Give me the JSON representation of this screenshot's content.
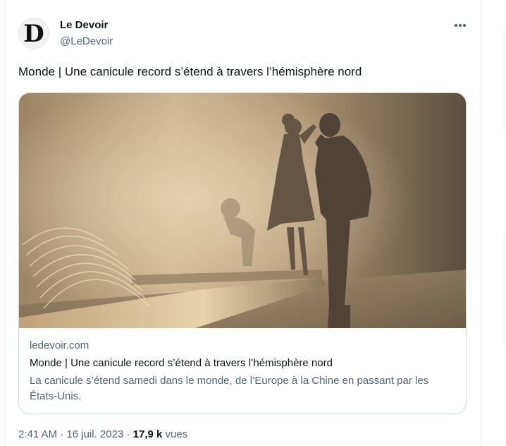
{
  "tweet": {
    "author": {
      "display_name": "Le Devoir",
      "handle": "@LeDevoir",
      "avatar_letter": "D"
    },
    "more_icon": "more-horizontal-icon",
    "text": "Monde | Une canicule record s’étend à travers l’hémisphère nord",
    "card": {
      "domain": "ledevoir.com",
      "title": "Monde | Une canicule record s’étend à travers l’hémisphère nord",
      "description": "La canicule s’étend samedi dans le monde, de l’Europe à la Chine en passant par les États-Unis."
    },
    "meta": {
      "time": "2:41 AM",
      "separator": "·",
      "date": "16 juil. 2023",
      "views_count": "17,9 k",
      "views_label": "vues"
    }
  },
  "colors": {
    "text_primary": "#0f1419",
    "text_secondary": "#536471",
    "border": "#cfd9de"
  }
}
